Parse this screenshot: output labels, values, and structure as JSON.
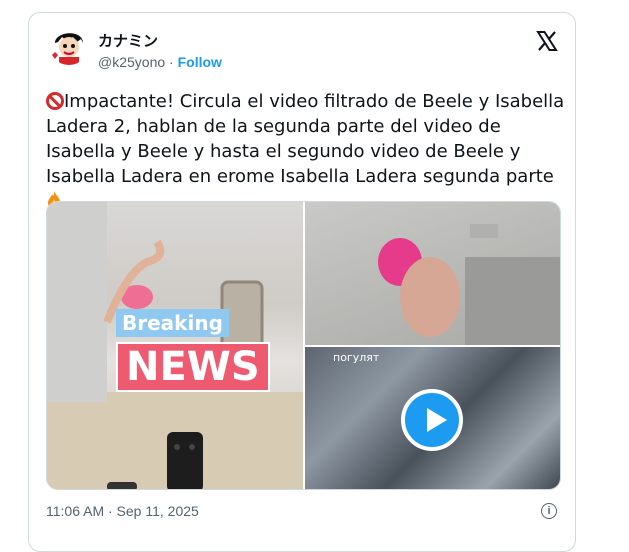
{
  "tweet": {
    "author_name": "カナミン",
    "handle": "@k25yono",
    "separator": "·",
    "follow_label": "Follow",
    "text": "Impactante! Circula el video filtrado de Beele y Isabella Ladera 2, hablan de la segunda parte del video de Isabella y Beele y hasta el segundo video de Beele y Isabella Ladera en erome Isabella Ladera segunda parte",
    "timestamp": "11:06 AM · Sep 11, 2025"
  },
  "media": {
    "breaking_label": "Breaking",
    "news_label": "NEWS",
    "overlay_text": "погулят"
  },
  "icons": {
    "logo": "x-logo-icon",
    "info": "info-icon",
    "play": "play-icon",
    "prohibited": "no-entry-icon",
    "fire": "fire-icon"
  },
  "colors": {
    "accent": "#1d9bf0",
    "news_red": "#ee5a6f",
    "breaking_blue": "#8fc8f0",
    "muted": "#536471"
  }
}
